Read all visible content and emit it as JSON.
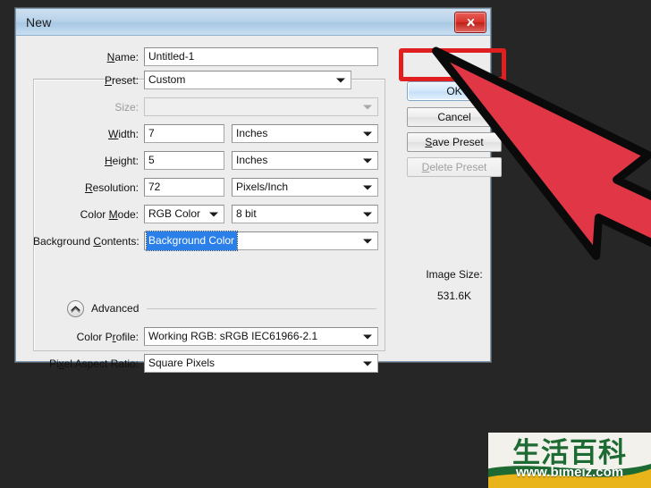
{
  "window": {
    "title": "New",
    "close_icon": "close-x-icon"
  },
  "form": {
    "name": {
      "label": "Name:",
      "label_prefix": "N",
      "label_rest": "ame:",
      "value": "Untitled-1"
    },
    "preset": {
      "label": "Preset:",
      "label_prefix": "P",
      "label_rest": "reset:",
      "value": "Custom"
    },
    "size": {
      "label": "Size:",
      "value": "",
      "disabled": true
    },
    "width": {
      "label": "Width:",
      "label_prefix": "W",
      "label_rest": "idth:",
      "value": "7",
      "unit": "Inches"
    },
    "height": {
      "label": "Height:",
      "label_prefix": "H",
      "label_rest": "eight:",
      "value": "5",
      "unit": "Inches"
    },
    "resolution": {
      "label": "Resolution:",
      "label_prefix": "R",
      "label_rest": "esolution:",
      "value": "72",
      "unit": "Pixels/Inch"
    },
    "color_mode": {
      "label": "Color Mode:",
      "label_prefix": "Color ",
      "label_rest": "ode:",
      "label_mnemonic": "M",
      "value": "RGB Color",
      "depth": "8 bit"
    },
    "background_contents": {
      "label": "Background Contents:",
      "label_prefix": "Background ",
      "label_mnemonic": "C",
      "label_rest": "ontents:",
      "value": "Background Color",
      "selected": true
    },
    "advanced": {
      "label": "Advanced",
      "toggle_icon": "chevron-up-icon",
      "expanded": true
    },
    "color_profile": {
      "label": "Color Profile:",
      "label_prefix": "Color P",
      "label_mnemonic": "r",
      "label_rest": "ofile:",
      "value": "Working RGB:  sRGB IEC61966-2.1"
    },
    "pixel_aspect_ratio": {
      "label": "Pixel Aspect Ratio:",
      "label_prefix": "Pi",
      "label_mnemonic": "x",
      "label_rest": "el Aspect Ratio:",
      "value": "Square Pixels"
    }
  },
  "buttons": {
    "ok": "OK",
    "cancel": "Cancel",
    "save_preset": "Save Preset",
    "save_preset_prefix": "S",
    "save_preset_rest": "ave Preset",
    "delete_preset": "Delete Preset",
    "delete_preset_prefix": "D",
    "delete_preset_rest": "elete Preset",
    "delete_preset_disabled": true
  },
  "image_size": {
    "label": "Image Size:",
    "value": "531.6K"
  },
  "highlight": {
    "target": "ok-button",
    "color": "#e02020"
  },
  "cursor": {
    "fill": "#e03646",
    "stroke": "#0a0a0a"
  },
  "watermark": {
    "cjk_text": "生活百科",
    "url": "www.bimeiz.com",
    "green": "#1d6b32",
    "yellow": "#e8b419"
  }
}
